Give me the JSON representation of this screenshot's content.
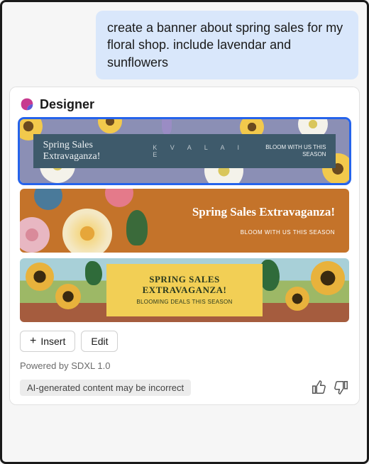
{
  "chat": {
    "user_message": "create a banner about spring sales for my floral shop. include lavendar and sunflowers"
  },
  "designer": {
    "title": "Designer",
    "banners": [
      {
        "title": "Spring Sales Extravaganza!",
        "mid_text": "K  V  A  L  A  I  E",
        "subtitle": "BLOOM WITH US THIS SEASON",
        "selected": true
      },
      {
        "title": "Spring Sales Extravaganza!",
        "subtitle": "BLOOM WITH US THIS SEASON",
        "selected": false
      },
      {
        "title": "SPRING SALES EXTRAVAGANZA!",
        "subtitle": "BLOOMING DEALS THIS SEASON",
        "selected": false
      }
    ],
    "actions": {
      "insert_label": "Insert",
      "edit_label": "Edit"
    },
    "powered_by": "Powered by SDXL 1.0",
    "disclaimer": "AI-generated content may be incorrect"
  }
}
